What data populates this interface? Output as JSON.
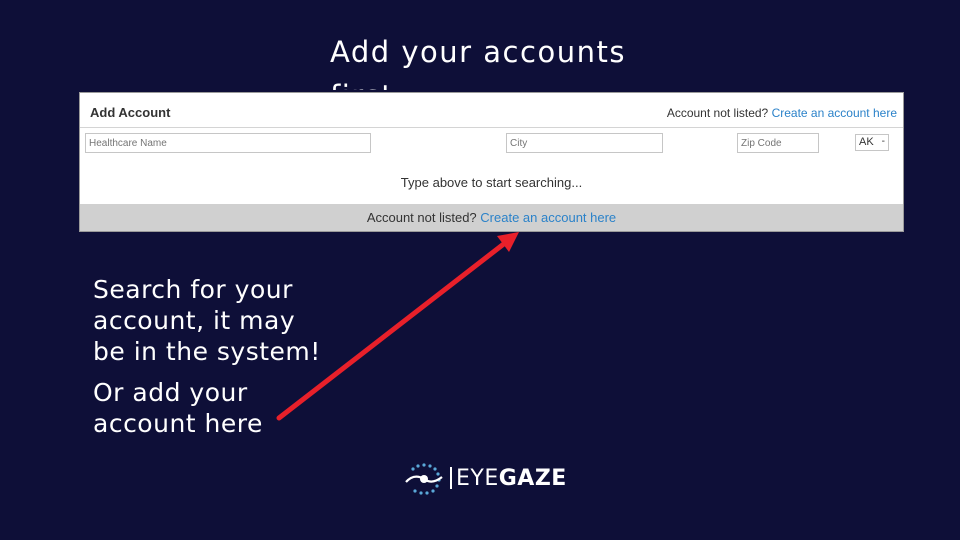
{
  "slide": {
    "title": "Add your accounts first",
    "caption_search": "Search for your account, it may be in the system!",
    "caption_add": "Or add your account here"
  },
  "panel": {
    "title": "Add Account",
    "header_prompt": "Account not listed?",
    "header_link": "Create an account here",
    "fields": {
      "healthcare_name_placeholder": "Healthcare Name",
      "city_placeholder": "City",
      "zip_placeholder": "Zip Code",
      "state_value": "AK"
    },
    "hint": "Type above to start searching...",
    "footer_prompt": "Account not listed?",
    "footer_link": "Create an account here"
  },
  "logo": {
    "word_regular": "EYE",
    "word_bold": "GAZE"
  },
  "colors": {
    "background": "#0e0f38",
    "link": "#2b82c9",
    "arrow": "#e8202a",
    "footer_bar": "#d0d0d0"
  },
  "icons": [
    "eye-logo-icon",
    "chevron-down-icon",
    "arrow-pointer-icon"
  ]
}
